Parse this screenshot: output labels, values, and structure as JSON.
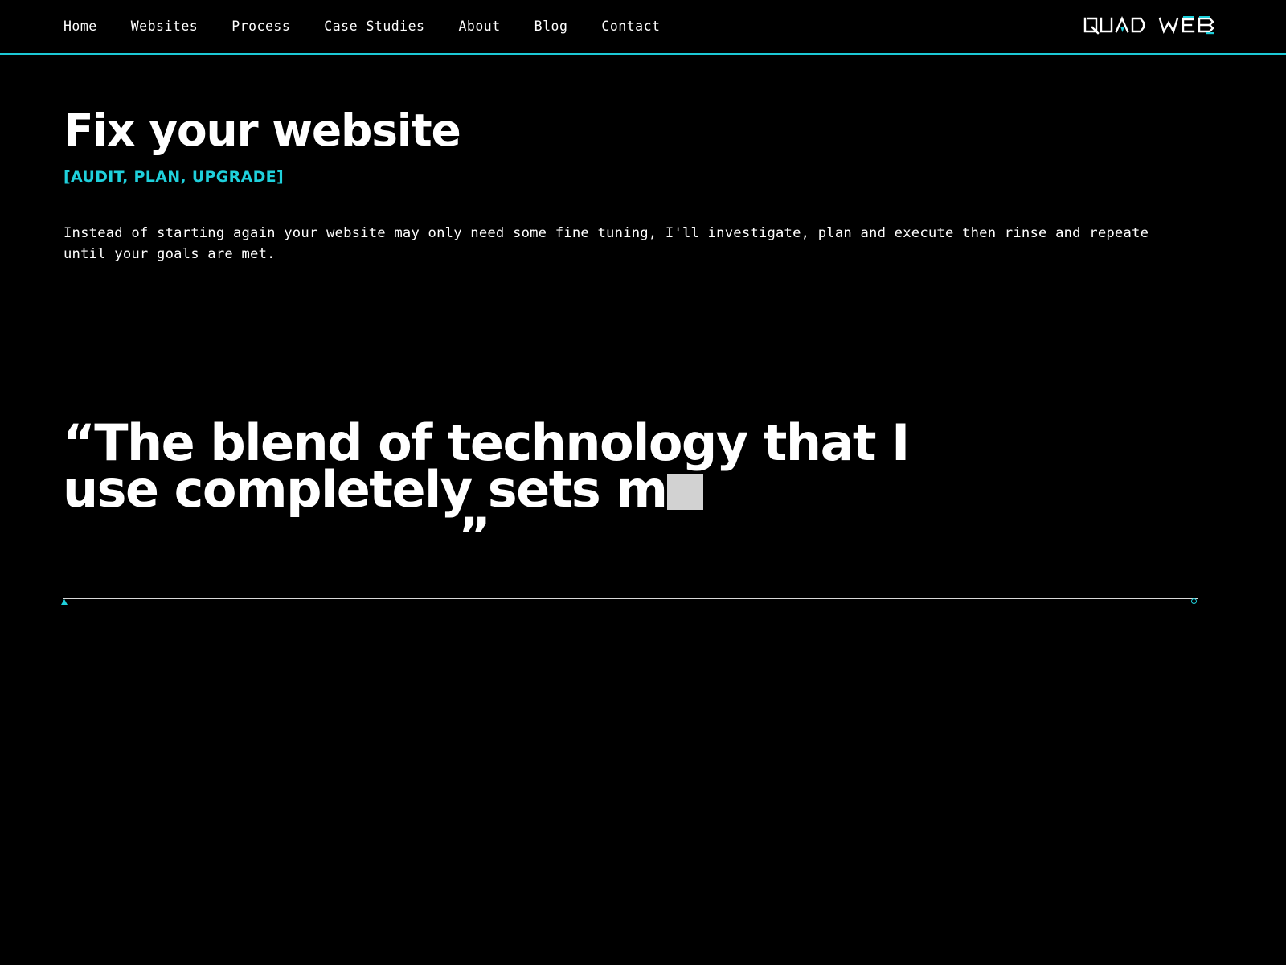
{
  "theme": {
    "background": "#000000",
    "text": "#ffffff",
    "accent": "#1fd0dc",
    "rule": "#d9d9d9",
    "tofu": "#d2d2d2"
  },
  "nav": {
    "items": [
      {
        "label": "Home"
      },
      {
        "label": "Websites"
      },
      {
        "label": "Process"
      },
      {
        "label": "Case Studies"
      },
      {
        "label": "About"
      },
      {
        "label": "Blog"
      },
      {
        "label": "Contact"
      }
    ],
    "logo": {
      "icon": "quad-web-logo",
      "text": "QUAD WEB",
      "word_one": "QUAD",
      "word_two": "WEB"
    }
  },
  "hero": {
    "title": "Fix your website",
    "kicker": "[AUDIT, PLAN, UPGRADE]",
    "body": "Instead of starting again your website may only need some fine tuning, I'll investigate, plan and execute then rinse and repeate until your goals are met."
  },
  "quote": {
    "line1": "“The blend of technology that I",
    "line2_before_glyph": "use completely sets m",
    "missing_glyph": "",
    "closing_mark": "”"
  },
  "rail": {
    "left_marker": "triangle-up-icon",
    "right_marker": "circle-outline-icon"
  }
}
